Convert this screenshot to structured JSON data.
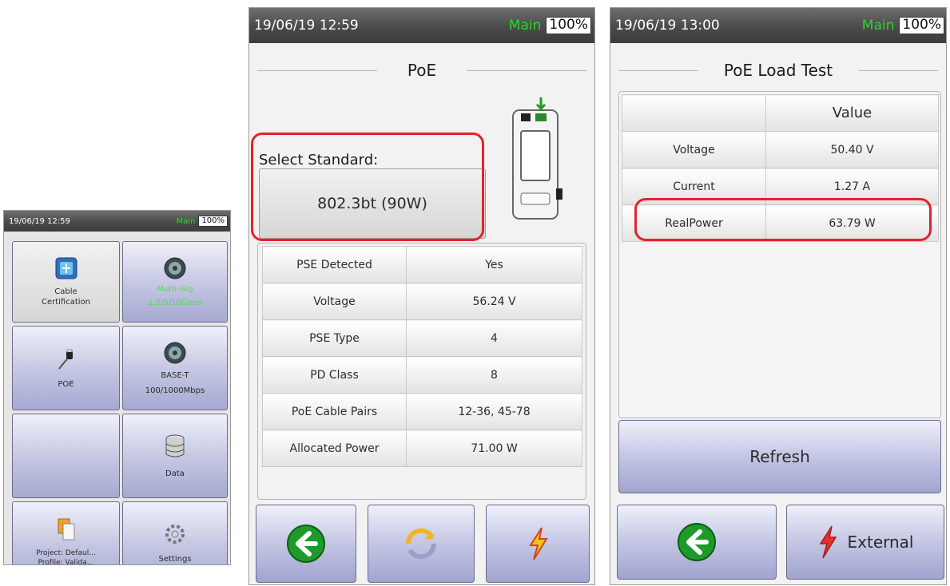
{
  "left_screen": {
    "status": {
      "time": "19/06/19 12:59",
      "mode": "Main",
      "battery": "100%"
    },
    "tiles": [
      {
        "label": "Cable\nCertification",
        "icon": "cable-certification-icon"
      },
      {
        "label": "Multi-Gig",
        "sublabel": "1.2/5/10Gbps",
        "icon": "multi-gig-icon"
      },
      {
        "label": "POE",
        "icon": "poe-plug-icon"
      },
      {
        "label": "BASE-T",
        "sublabel": "100/1000Mbps",
        "icon": "base-t-icon"
      },
      {
        "label": "",
        "icon": ""
      },
      {
        "label": "Data",
        "icon": "database-icon"
      },
      {
        "label": "Project: Defaul...\nProfile: Valida...",
        "icon": "documents-icon"
      },
      {
        "label": "Settings",
        "icon": "gear-icon"
      }
    ]
  },
  "poe_screen": {
    "status": {
      "time": "19/06/19 12:59",
      "mode": "Main",
      "battery": "100%"
    },
    "title": "PoE",
    "select_label": "Select Standard:",
    "standard_value": "802.3bt (90W)",
    "rows": [
      {
        "label": "PSE Detected",
        "value": "Yes"
      },
      {
        "label": "Voltage",
        "value": "56.24 V"
      },
      {
        "label": "PSE Type",
        "value": "4"
      },
      {
        "label": "PD Class",
        "value": "8"
      },
      {
        "label": "PoE Cable Pairs",
        "value": "12-36, 45-78"
      },
      {
        "label": "Allocated Power",
        "value": "71.00 W"
      }
    ],
    "buttons": [
      "back-arrow-icon",
      "refresh-icon",
      "lightning-icon"
    ]
  },
  "load_screen": {
    "status": {
      "time": "19/06/19 13:00",
      "mode": "Main",
      "battery": "100%"
    },
    "title": "PoE Load Test",
    "header": {
      "label": "",
      "value": "Value"
    },
    "rows": [
      {
        "label": "Voltage",
        "value": "50.40 V"
      },
      {
        "label": "Current",
        "value": "1.27 A"
      },
      {
        "label": "RealPower",
        "value": "63.79 W"
      }
    ],
    "refresh_label": "Refresh",
    "external_label": "External"
  },
  "colors": {
    "accent_green": "#29d829",
    "highlight_red": "#e0242e",
    "button_blue": "#a0a4d0"
  }
}
